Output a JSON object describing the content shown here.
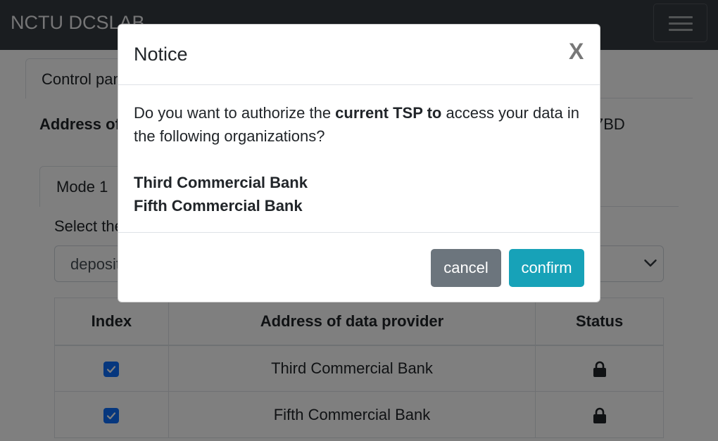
{
  "navbar": {
    "brand": "NCTU DCSLAB"
  },
  "page": {
    "top_tab": "Control panel",
    "address_label": "Address of",
    "address_value_tail": "7BD",
    "mode_tab": "Mode 1",
    "select_label": "Select the",
    "select_value": "deposit"
  },
  "table": {
    "headers": [
      "Index",
      "Address of data provider",
      "Status"
    ],
    "rows": [
      {
        "checked": true,
        "provider": "Third Commercial Bank",
        "status": "locked"
      },
      {
        "checked": true,
        "provider": "Fifth Commercial Bank",
        "status": "locked"
      }
    ]
  },
  "modal": {
    "title": "Notice",
    "close": "X",
    "question_pre": "Do you want to authorize the ",
    "question_bold": "current TSP to",
    "question_post": " access your data in the following organizations?",
    "organizations": [
      "Third Commercial Bank",
      "Fifth Commercial Bank"
    ],
    "cancel_label": "cancel",
    "confirm_label": "confirm"
  },
  "colors": {
    "navbar_bg": "#343a40",
    "checkbox": "#0d6efd",
    "cancel_button": "#6c757d",
    "confirm_button": "#17a2b8"
  },
  "icons": {
    "menu": "hamburger-icon",
    "chevron": "chevron-down-icon",
    "lock": "lock-icon",
    "check": "check-icon"
  }
}
